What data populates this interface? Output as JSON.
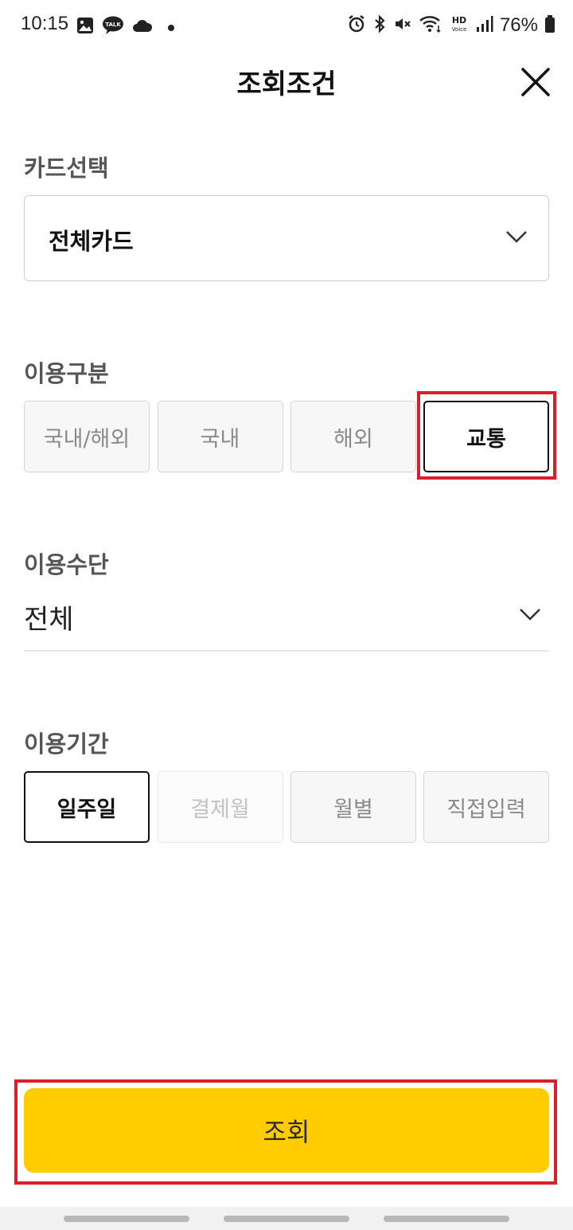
{
  "status_bar": {
    "time": "10:15",
    "left_icons": [
      "gallery-icon",
      "kakaotalk-icon",
      "cloud-icon",
      "dot-icon"
    ],
    "kakao_badge": "TALK",
    "right_icons": [
      "alarm-icon",
      "bluetooth-icon",
      "mute-icon",
      "wifi-icon",
      "hd-voice-icon",
      "signal-icon",
      "battery-icon"
    ],
    "hd_label": "HD",
    "voice_label": "Voice",
    "battery": "76%"
  },
  "header": {
    "title": "조회조건",
    "close_icon": "close-icon"
  },
  "card_section": {
    "label": "카드선택",
    "selected": "전체카드"
  },
  "usage_type_section": {
    "label": "이용구분",
    "options": [
      "국내/해외",
      "국내",
      "해외",
      "교통"
    ],
    "selected": "교통"
  },
  "method_section": {
    "label": "이용수단",
    "selected": "전체"
  },
  "period_section": {
    "label": "이용기간",
    "options": [
      "일주일",
      "결제월",
      "월별",
      "직접입력"
    ],
    "selected": "일주일",
    "disabled": "결제월"
  },
  "submit": {
    "label": "조회"
  },
  "colors": {
    "accent": "#ffcc00",
    "highlight": "#d9202a",
    "selected_border": "#111111"
  }
}
